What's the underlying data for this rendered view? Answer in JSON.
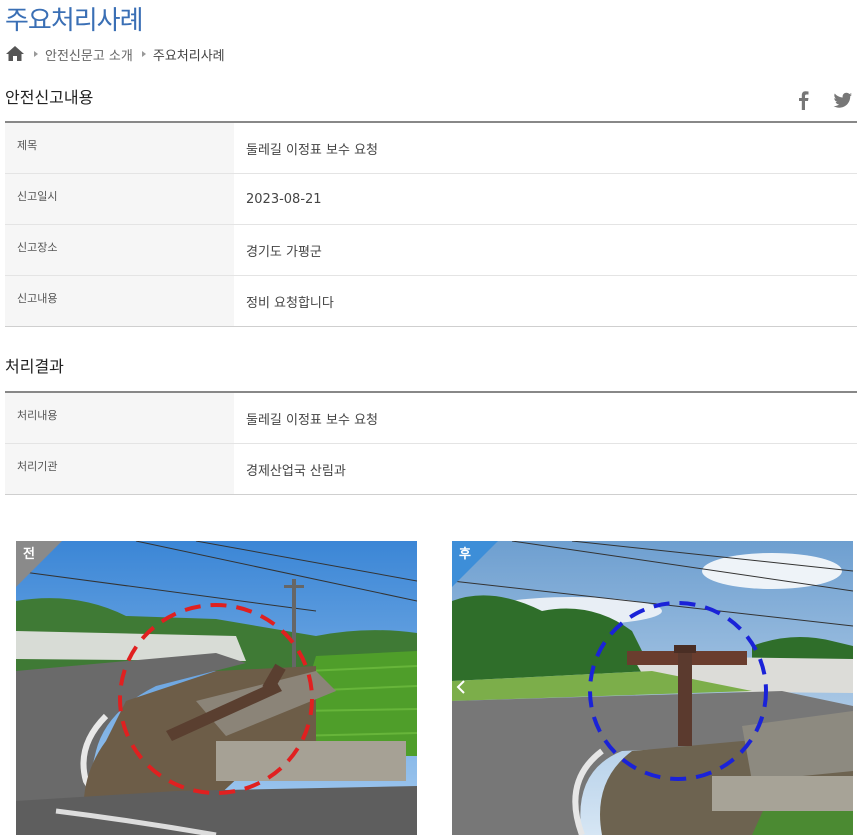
{
  "page": {
    "title": "주요처리사례"
  },
  "breadcrumb": {
    "items": [
      "안전신문고 소개",
      "주요처리사례"
    ]
  },
  "report": {
    "section_title": "안전신고내용",
    "rows": [
      {
        "label": "제목",
        "value": "둘레길 이정표 보수 요청"
      },
      {
        "label": "신고일시",
        "value": "2023-08-21"
      },
      {
        "label": "신고장소",
        "value": "경기도 가평군"
      },
      {
        "label": "신고내용",
        "value": "정비 요청합니다"
      }
    ]
  },
  "share": {
    "icons": [
      "facebook-icon",
      "twitter-icon"
    ]
  },
  "result": {
    "section_title": "처리결과",
    "rows": [
      {
        "label": "처리내용",
        "value": "둘레길 이정표 보수 요청"
      },
      {
        "label": "처리기관",
        "value": "경제산업국 산림과"
      }
    ]
  },
  "photos": {
    "before": {
      "badge": "전",
      "circle_color": "#e02020"
    },
    "after": {
      "badge": "후",
      "circle_color": "#1a22d8"
    }
  },
  "colors": {
    "title": "#3a6fb5",
    "badge_before": "#8a8a8a",
    "badge_after": "#3d8ed8"
  }
}
